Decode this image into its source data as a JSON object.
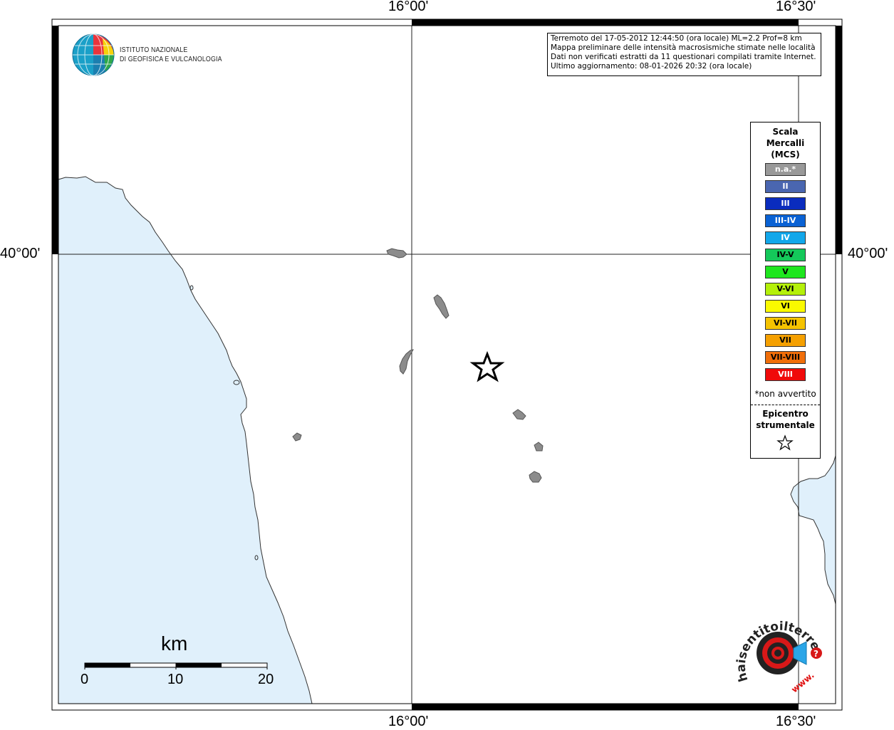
{
  "map": {
    "grid_labels": {
      "lon_left": "16°00'",
      "lon_right": "16°30'",
      "lat": "40°00'"
    },
    "colors": {
      "sea": "#e0f0fb",
      "land": "#ffffff",
      "town": "#8c8c8c",
      "frame": "#000000"
    }
  },
  "logo": {
    "line1": "ISTITUTO NAZIONALE",
    "line2": "DI GEOFISICA E VULCANOLOGIA",
    "icon": "ingv-globe-icon"
  },
  "info": {
    "line1": "Terremoto del 17-05-2012 12:44:50 (ora locale) ML=2.2 Prof=8 km",
    "line2": "Mappa preliminare delle intensità macrosismiche stimate nelle località",
    "line3": "Dati non verificati estratti da 11 questionari compilati tramite Internet.",
    "line4": "Ultimo aggiornamento: 08-01-2026 20:32 (ora locale)"
  },
  "legend": {
    "title1": "Scala",
    "title2": "Mercalli",
    "title3": "(MCS)",
    "items": [
      {
        "label": "n.a.*",
        "color": "#999999",
        "text_color": "#ffffff"
      },
      {
        "label": "II",
        "color": "#4a66b0",
        "text_color": "#ffffff"
      },
      {
        "label": "III",
        "color": "#0a2cbe",
        "text_color": "#ffffff"
      },
      {
        "label": "III-IV",
        "color": "#0a62d4",
        "text_color": "#ffffff"
      },
      {
        "label": "IV",
        "color": "#12a7ea",
        "text_color": "#ffffff"
      },
      {
        "label": "IV-V",
        "color": "#14c85a",
        "text_color": "#000000"
      },
      {
        "label": "V",
        "color": "#1ee61e",
        "text_color": "#000000"
      },
      {
        "label": "V-VI",
        "color": "#b4f00a",
        "text_color": "#000000"
      },
      {
        "label": "VI",
        "color": "#fafa00",
        "text_color": "#000000"
      },
      {
        "label": "VI-VII",
        "color": "#f5c300",
        "text_color": "#000000"
      },
      {
        "label": "VII",
        "color": "#f5a000",
        "text_color": "#000000"
      },
      {
        "label": "VII-VIII",
        "color": "#f06e0a",
        "text_color": "#000000"
      },
      {
        "label": "VIII",
        "color": "#f00a0a",
        "text_color": "#ffffff"
      }
    ],
    "note": "*non avvertito",
    "epicenter1": "Epicentro",
    "epicenter2": "strumentale",
    "epicenter_icon": "star-icon"
  },
  "scale": {
    "unit": "km",
    "ticks": [
      "0",
      "10",
      "20"
    ]
  },
  "badge": {
    "text": "haisentitoilterremoto.it",
    "prefix": "www.",
    "icon": "hai-sentito-logo-icon"
  }
}
